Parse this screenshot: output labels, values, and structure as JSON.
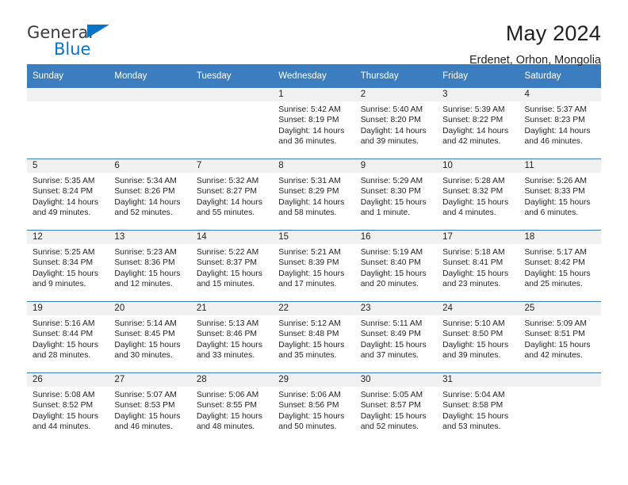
{
  "brand": {
    "name_part1": "General",
    "name_part2": "Blue",
    "flag_icon": "triangle-flag-icon"
  },
  "header": {
    "title": "May 2024",
    "location": "Erdenet, Orhon, Mongolia"
  },
  "colors": {
    "header_blue": "#3c7dbf",
    "brand_blue": "#0a74c4",
    "daynum_band": "#f0f0f0",
    "text": "#231f20"
  },
  "weekday_headers": [
    "Sunday",
    "Monday",
    "Tuesday",
    "Wednesday",
    "Thursday",
    "Friday",
    "Saturday"
  ],
  "labels": {
    "sunrise_prefix": "Sunrise:",
    "sunset_prefix": "Sunset:",
    "daylight_prefix": "Daylight:"
  },
  "weeks": [
    [
      {
        "day": "",
        "empty": true
      },
      {
        "day": "",
        "empty": true
      },
      {
        "day": "",
        "empty": true
      },
      {
        "day": "1",
        "sunrise": "Sunrise: 5:42 AM",
        "sunset": "Sunset: 8:19 PM",
        "daylight_line1": "Daylight: 14 hours",
        "daylight_line2": "and 36 minutes."
      },
      {
        "day": "2",
        "sunrise": "Sunrise: 5:40 AM",
        "sunset": "Sunset: 8:20 PM",
        "daylight_line1": "Daylight: 14 hours",
        "daylight_line2": "and 39 minutes."
      },
      {
        "day": "3",
        "sunrise": "Sunrise: 5:39 AM",
        "sunset": "Sunset: 8:22 PM",
        "daylight_line1": "Daylight: 14 hours",
        "daylight_line2": "and 42 minutes."
      },
      {
        "day": "4",
        "sunrise": "Sunrise: 5:37 AM",
        "sunset": "Sunset: 8:23 PM",
        "daylight_line1": "Daylight: 14 hours",
        "daylight_line2": "and 46 minutes."
      }
    ],
    [
      {
        "day": "5",
        "sunrise": "Sunrise: 5:35 AM",
        "sunset": "Sunset: 8:24 PM",
        "daylight_line1": "Daylight: 14 hours",
        "daylight_line2": "and 49 minutes."
      },
      {
        "day": "6",
        "sunrise": "Sunrise: 5:34 AM",
        "sunset": "Sunset: 8:26 PM",
        "daylight_line1": "Daylight: 14 hours",
        "daylight_line2": "and 52 minutes."
      },
      {
        "day": "7",
        "sunrise": "Sunrise: 5:32 AM",
        "sunset": "Sunset: 8:27 PM",
        "daylight_line1": "Daylight: 14 hours",
        "daylight_line2": "and 55 minutes."
      },
      {
        "day": "8",
        "sunrise": "Sunrise: 5:31 AM",
        "sunset": "Sunset: 8:29 PM",
        "daylight_line1": "Daylight: 14 hours",
        "daylight_line2": "and 58 minutes."
      },
      {
        "day": "9",
        "sunrise": "Sunrise: 5:29 AM",
        "sunset": "Sunset: 8:30 PM",
        "daylight_line1": "Daylight: 15 hours",
        "daylight_line2": "and 1 minute."
      },
      {
        "day": "10",
        "sunrise": "Sunrise: 5:28 AM",
        "sunset": "Sunset: 8:32 PM",
        "daylight_line1": "Daylight: 15 hours",
        "daylight_line2": "and 4 minutes."
      },
      {
        "day": "11",
        "sunrise": "Sunrise: 5:26 AM",
        "sunset": "Sunset: 8:33 PM",
        "daylight_line1": "Daylight: 15 hours",
        "daylight_line2": "and 6 minutes."
      }
    ],
    [
      {
        "day": "12",
        "sunrise": "Sunrise: 5:25 AM",
        "sunset": "Sunset: 8:34 PM",
        "daylight_line1": "Daylight: 15 hours",
        "daylight_line2": "and 9 minutes."
      },
      {
        "day": "13",
        "sunrise": "Sunrise: 5:23 AM",
        "sunset": "Sunset: 8:36 PM",
        "daylight_line1": "Daylight: 15 hours",
        "daylight_line2": "and 12 minutes."
      },
      {
        "day": "14",
        "sunrise": "Sunrise: 5:22 AM",
        "sunset": "Sunset: 8:37 PM",
        "daylight_line1": "Daylight: 15 hours",
        "daylight_line2": "and 15 minutes."
      },
      {
        "day": "15",
        "sunrise": "Sunrise: 5:21 AM",
        "sunset": "Sunset: 8:39 PM",
        "daylight_line1": "Daylight: 15 hours",
        "daylight_line2": "and 17 minutes."
      },
      {
        "day": "16",
        "sunrise": "Sunrise: 5:19 AM",
        "sunset": "Sunset: 8:40 PM",
        "daylight_line1": "Daylight: 15 hours",
        "daylight_line2": "and 20 minutes."
      },
      {
        "day": "17",
        "sunrise": "Sunrise: 5:18 AM",
        "sunset": "Sunset: 8:41 PM",
        "daylight_line1": "Daylight: 15 hours",
        "daylight_line2": "and 23 minutes."
      },
      {
        "day": "18",
        "sunrise": "Sunrise: 5:17 AM",
        "sunset": "Sunset: 8:42 PM",
        "daylight_line1": "Daylight: 15 hours",
        "daylight_line2": "and 25 minutes."
      }
    ],
    [
      {
        "day": "19",
        "sunrise": "Sunrise: 5:16 AM",
        "sunset": "Sunset: 8:44 PM",
        "daylight_line1": "Daylight: 15 hours",
        "daylight_line2": "and 28 minutes."
      },
      {
        "day": "20",
        "sunrise": "Sunrise: 5:14 AM",
        "sunset": "Sunset: 8:45 PM",
        "daylight_line1": "Daylight: 15 hours",
        "daylight_line2": "and 30 minutes."
      },
      {
        "day": "21",
        "sunrise": "Sunrise: 5:13 AM",
        "sunset": "Sunset: 8:46 PM",
        "daylight_line1": "Daylight: 15 hours",
        "daylight_line2": "and 33 minutes."
      },
      {
        "day": "22",
        "sunrise": "Sunrise: 5:12 AM",
        "sunset": "Sunset: 8:48 PM",
        "daylight_line1": "Daylight: 15 hours",
        "daylight_line2": "and 35 minutes."
      },
      {
        "day": "23",
        "sunrise": "Sunrise: 5:11 AM",
        "sunset": "Sunset: 8:49 PM",
        "daylight_line1": "Daylight: 15 hours",
        "daylight_line2": "and 37 minutes."
      },
      {
        "day": "24",
        "sunrise": "Sunrise: 5:10 AM",
        "sunset": "Sunset: 8:50 PM",
        "daylight_line1": "Daylight: 15 hours",
        "daylight_line2": "and 39 minutes."
      },
      {
        "day": "25",
        "sunrise": "Sunrise: 5:09 AM",
        "sunset": "Sunset: 8:51 PM",
        "daylight_line1": "Daylight: 15 hours",
        "daylight_line2": "and 42 minutes."
      }
    ],
    [
      {
        "day": "26",
        "sunrise": "Sunrise: 5:08 AM",
        "sunset": "Sunset: 8:52 PM",
        "daylight_line1": "Daylight: 15 hours",
        "daylight_line2": "and 44 minutes."
      },
      {
        "day": "27",
        "sunrise": "Sunrise: 5:07 AM",
        "sunset": "Sunset: 8:53 PM",
        "daylight_line1": "Daylight: 15 hours",
        "daylight_line2": "and 46 minutes."
      },
      {
        "day": "28",
        "sunrise": "Sunrise: 5:06 AM",
        "sunset": "Sunset: 8:55 PM",
        "daylight_line1": "Daylight: 15 hours",
        "daylight_line2": "and 48 minutes."
      },
      {
        "day": "29",
        "sunrise": "Sunrise: 5:06 AM",
        "sunset": "Sunset: 8:56 PM",
        "daylight_line1": "Daylight: 15 hours",
        "daylight_line2": "and 50 minutes."
      },
      {
        "day": "30",
        "sunrise": "Sunrise: 5:05 AM",
        "sunset": "Sunset: 8:57 PM",
        "daylight_line1": "Daylight: 15 hours",
        "daylight_line2": "and 52 minutes."
      },
      {
        "day": "31",
        "sunrise": "Sunrise: 5:04 AM",
        "sunset": "Sunset: 8:58 PM",
        "daylight_line1": "Daylight: 15 hours",
        "daylight_line2": "and 53 minutes."
      },
      {
        "day": "",
        "empty": true
      }
    ]
  ]
}
